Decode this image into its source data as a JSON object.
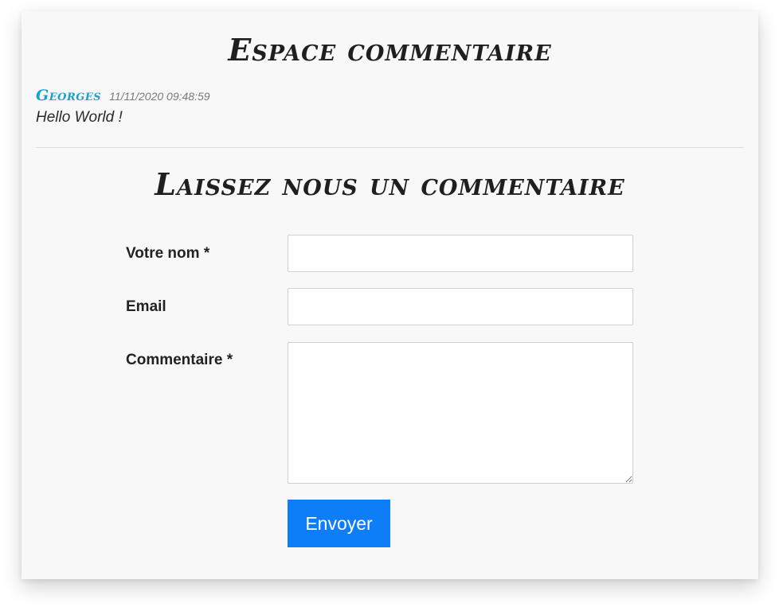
{
  "section_title": "Espace commentaire",
  "comments": [
    {
      "author": "Georges",
      "timestamp": "11/11/2020 09:48:59",
      "text": "Hello World !"
    }
  ],
  "form": {
    "title": "Laissez nous un commentaire",
    "name_label": "Votre nom *",
    "name_value": "",
    "email_label": "Email",
    "email_value": "",
    "comment_label": "Commentaire *",
    "comment_value": "",
    "submit_label": "Envoyer"
  },
  "colors": {
    "author": "#17a2c8",
    "submit_bg": "#0d7ef7",
    "card_bg": "#f8f8f8"
  }
}
